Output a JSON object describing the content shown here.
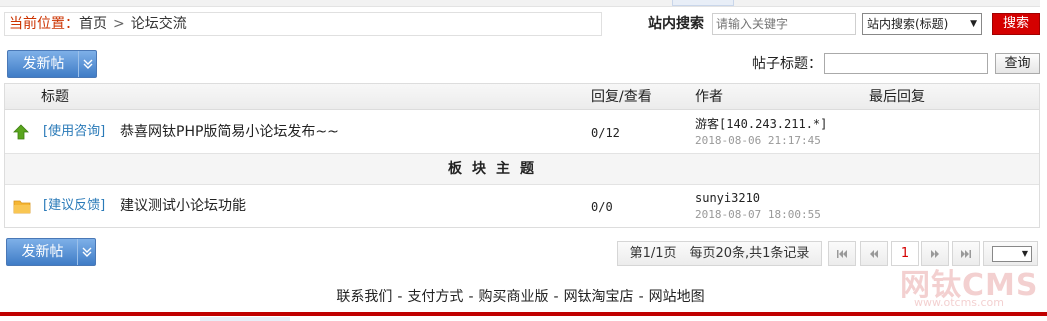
{
  "breadcrumb": {
    "label": "当前位置：",
    "home": "首页",
    "separator": ">",
    "current": "论坛交流"
  },
  "search": {
    "label": "站内搜索",
    "placeholder": "请输入关键字",
    "scope_selected": "站内搜索(标题)",
    "button": "搜索"
  },
  "new_post_button": "发新帖",
  "title_filter": {
    "label": "帖子标题：",
    "value": "",
    "button": "查询"
  },
  "table": {
    "columns": [
      "标题",
      "回复/查看",
      "作者",
      "最后回复"
    ],
    "top_posts": [
      {
        "icon": "arrow-up-icon",
        "category": "[使用咨询]",
        "title": "恭喜网钛PHP版简易小论坛发布~~",
        "replies_views": "0/12",
        "author": "游客[140.243.211.*]",
        "time": "2018-08-06 21:17:45"
      }
    ],
    "section_header": "板块主题",
    "posts": [
      {
        "icon": "folder-icon",
        "category": "[建议反馈]",
        "title": "建议测试小论坛功能",
        "replies_views": "0/0",
        "author": "sunyi3210",
        "time": "2018-08-07 18:00:55"
      }
    ]
  },
  "pagination": {
    "info": "第1/1页　每页20条,共1条记录",
    "current_page": "1",
    "first": "⏮",
    "prev": "◀◀",
    "next": "▶▶",
    "last": "⏭",
    "select_value": "▼"
  },
  "footer": {
    "links": [
      "联系我们",
      "支付方式",
      "购买商业版",
      "网钛淘宝店",
      "网站地图"
    ],
    "separator": "-"
  },
  "watermark": {
    "brand": "网钛CMS",
    "url": "www.otcms.com"
  },
  "colors": {
    "accent_red": "#d40000",
    "button_blue": "#3f7cc6",
    "category_blue": "#2a7ab8"
  }
}
